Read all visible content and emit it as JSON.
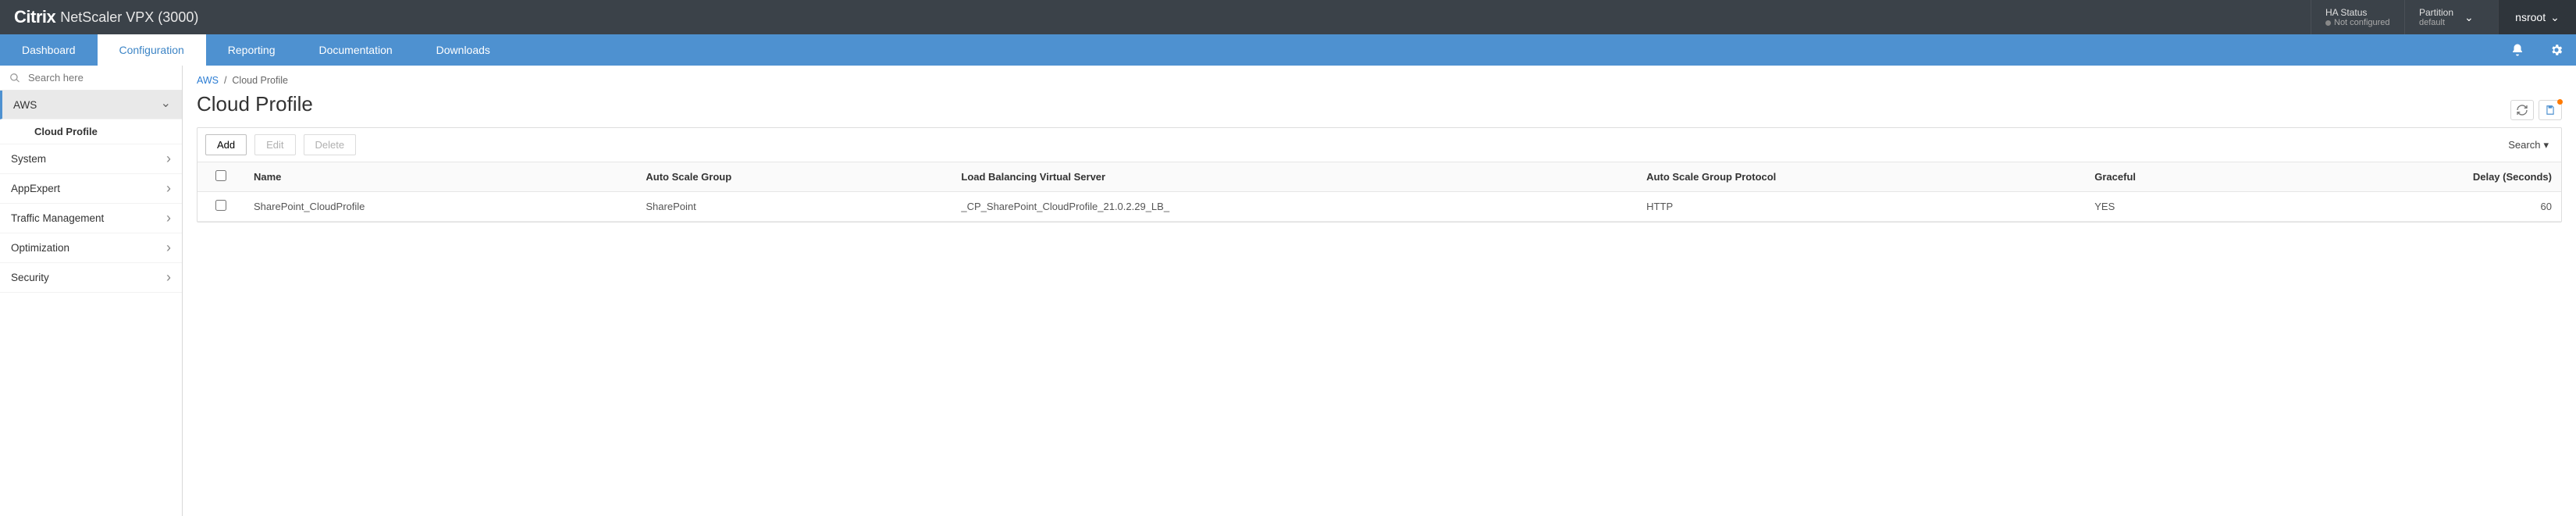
{
  "header": {
    "brand": "Citrix",
    "product": "NetScaler VPX (3000)",
    "ha_status_label": "HA Status",
    "ha_status_value": "Not configured",
    "partition_label": "Partition",
    "partition_value": "default",
    "user": "nsroot"
  },
  "nav": {
    "tabs": [
      {
        "label": "Dashboard"
      },
      {
        "label": "Configuration",
        "active": true
      },
      {
        "label": "Reporting"
      },
      {
        "label": "Documentation"
      },
      {
        "label": "Downloads"
      }
    ]
  },
  "sidebar": {
    "search_placeholder": "Search here",
    "items": [
      {
        "label": "AWS",
        "expanded": true
      },
      {
        "label": "System"
      },
      {
        "label": "AppExpert"
      },
      {
        "label": "Traffic Management"
      },
      {
        "label": "Optimization"
      },
      {
        "label": "Security"
      }
    ],
    "subitem": "Cloud Profile"
  },
  "breadcrumb": {
    "root": "AWS",
    "sep": "/",
    "leaf": "Cloud Profile"
  },
  "page": {
    "title": "Cloud Profile"
  },
  "toolbar": {
    "add": "Add",
    "edit": "Edit",
    "delete": "Delete",
    "search": "Search"
  },
  "table": {
    "columns": {
      "name": "Name",
      "asg": "Auto Scale Group",
      "lbvs": "Load Balancing Virtual Server",
      "proto": "Auto Scale Group Protocol",
      "graceful": "Graceful",
      "delay": "Delay (Seconds)"
    },
    "rows": [
      {
        "name": "SharePoint_CloudProfile",
        "asg": "SharePoint",
        "lbvs": "_CP_SharePoint_CloudProfile_21.0.2.29_LB_",
        "proto": "HTTP",
        "graceful": "YES",
        "delay": "60"
      }
    ]
  }
}
